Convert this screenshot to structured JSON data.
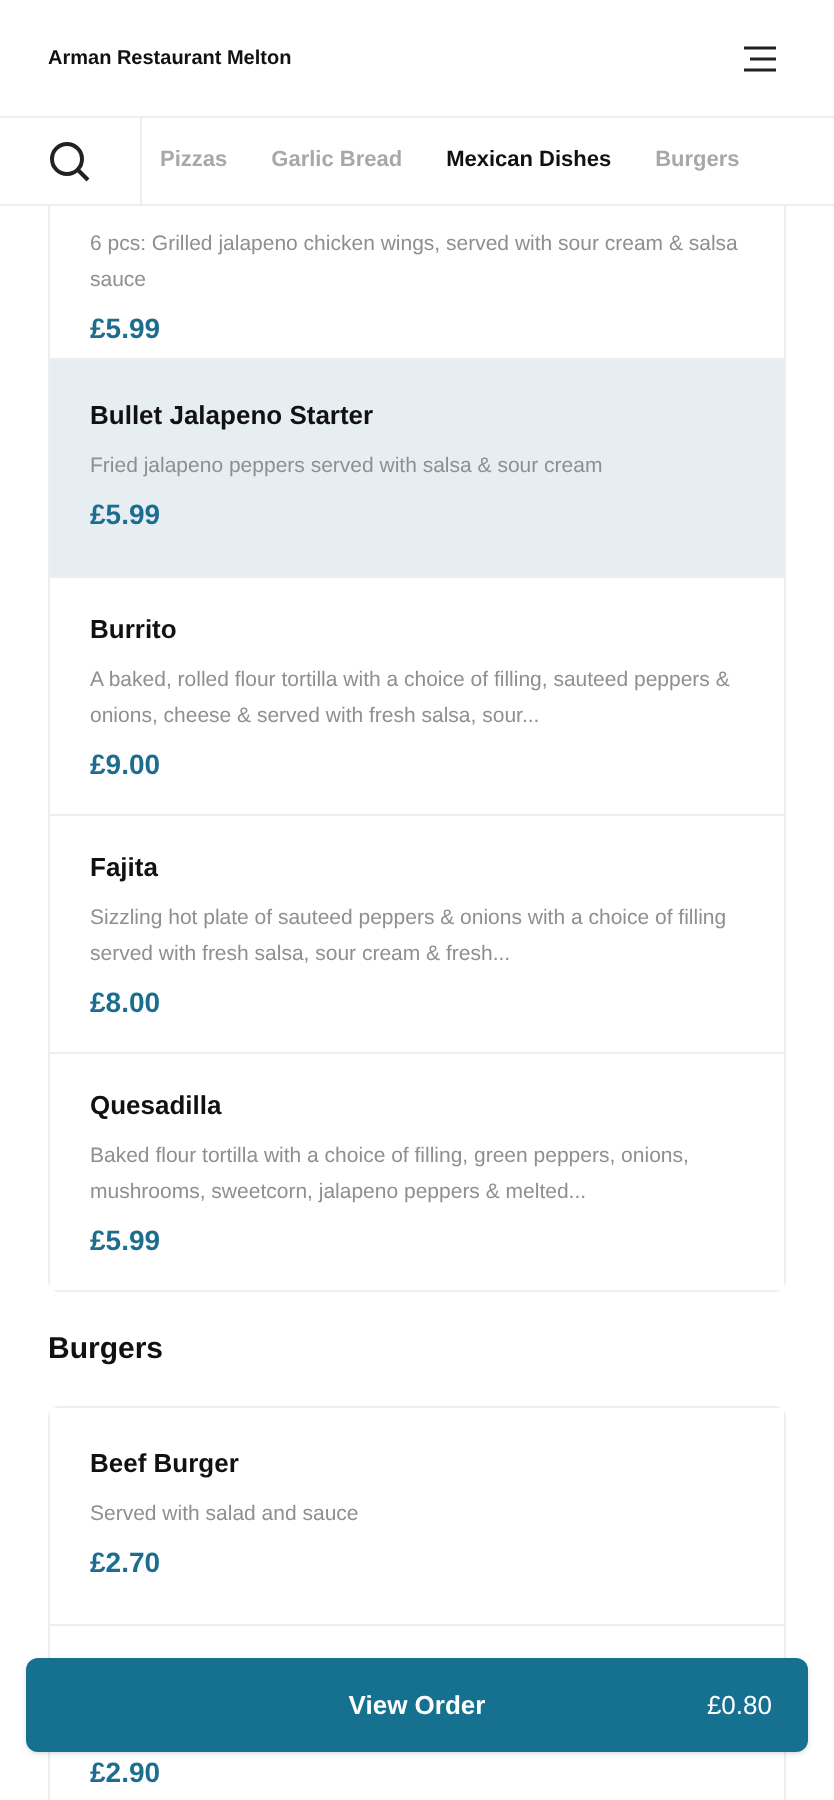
{
  "header": {
    "title": "Arman Restaurant Melton"
  },
  "tabs": [
    {
      "label": "Pizzas",
      "selected": false
    },
    {
      "label": "Garlic Bread",
      "selected": false
    },
    {
      "label": "Mexican Dishes",
      "selected": true
    },
    {
      "label": "Burgers",
      "selected": false
    }
  ],
  "sections": [
    {
      "items": [
        {
          "description": "6 pcs: Grilled jalapeno chicken wings, served with sour cream & salsa sauce",
          "price": "£5.99",
          "selected": false
        },
        {
          "name": "Bullet Jalapeno Starter",
          "description": "Fried jalapeno peppers served with salsa & sour cream",
          "price": "£5.99",
          "selected": true
        },
        {
          "name": "Burrito",
          "description": "A baked, rolled flour tortilla with a choice of filling, sauteed peppers & onions, cheese & served with fresh salsa, sour...",
          "price": "£9.00",
          "selected": false
        },
        {
          "name": "Fajita",
          "description": "Sizzling hot plate of sauteed peppers & onions with a choice of filling served with fresh salsa, sour cream & fresh...",
          "price": "£8.00",
          "selected": false
        },
        {
          "name": "Quesadilla",
          "description": "Baked flour tortilla with a choice of filling, green peppers, onions, mushrooms, sweetcorn, jalapeno peppers & melted...",
          "price": "£5.99",
          "selected": false
        }
      ]
    },
    {
      "heading": "Burgers",
      "items": [
        {
          "name": "Beef Burger",
          "description": "Served with salad and sauce",
          "price": "£2.70",
          "selected": false
        },
        {
          "price": "£2.90"
        }
      ]
    }
  ],
  "order_button": {
    "label": "View Order",
    "total": "£0.80"
  }
}
